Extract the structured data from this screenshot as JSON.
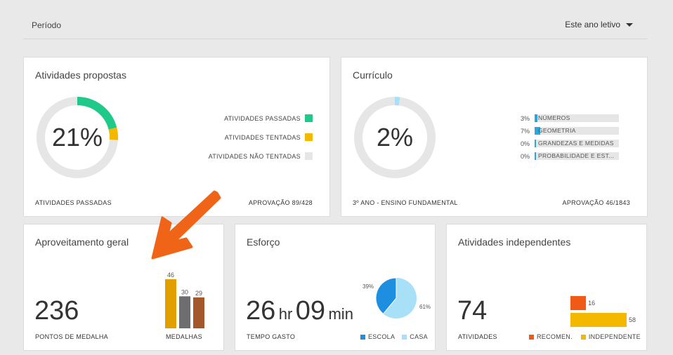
{
  "topbar": {
    "period_label": "Período",
    "period_value": "Este ano letivo"
  },
  "colors": {
    "passed": "#1fc98a",
    "attempted": "#f5b800",
    "not_attempted": "#e6e6e6",
    "curriculum": "#29a8e0",
    "bar_gold": "#e2a000",
    "bar_silver": "#6e6e70",
    "bar_bronze": "#a4572a",
    "school": "#1e8ee0",
    "home": "#a7e0f7",
    "recom": "#f05a14",
    "indep": "#f5b800",
    "arrow": "#f06418"
  },
  "atividades_propostas": {
    "title": "Atividades propostas",
    "donut_value": "21%",
    "passed_fraction": 0.21,
    "attempted_fraction": 0.05,
    "legend": [
      "ATIVIDADES PASSADAS",
      "ATIVIDADES TENTADAS",
      "ATIVIDADES NÃO TENTADAS"
    ],
    "footer_left": "ATIVIDADES PASSADAS",
    "footer_right": "APROVAÇÃO 89/428"
  },
  "curriculo": {
    "title": "Currículo",
    "donut_value": "2%",
    "fraction": 0.02,
    "rows": [
      {
        "pct": "3%",
        "label": "NÚMEROS",
        "value": 0.03
      },
      {
        "pct": "7%",
        "label": "GEOMETRIA",
        "value": 0.07
      },
      {
        "pct": "0%",
        "label": "GRANDEZAS E MEDIDAS",
        "value": 0
      },
      {
        "pct": "0%",
        "label": "PROBABILIDADE E EST...",
        "value": 0
      }
    ],
    "footer_left": "3º ANO - ENSINO FUNDAMENTAL",
    "footer_right": "APROVAÇÃO 46/1843"
  },
  "aproveitamento": {
    "title": "Aproveitamento geral",
    "points": "236",
    "points_label": "PONTOS DE MEDALHA",
    "medals_label": "MEDALHAS",
    "medals": [
      {
        "value": 46,
        "label": "46"
      },
      {
        "value": 30,
        "label": "30"
      },
      {
        "value": 29,
        "label": "29"
      }
    ]
  },
  "esforco": {
    "title": "Esforço",
    "hours": "26",
    "hours_unit": "hr",
    "minutes": "09",
    "minutes_unit": "min",
    "footer_left": "TEMPO GASTO",
    "school_pct": 39,
    "home_pct": 61,
    "school_label": "39%",
    "home_label": "61%",
    "legend_school": "ESCOLA",
    "legend_home": "CASA"
  },
  "independentes": {
    "title": "Atividades independentes",
    "count": "74",
    "footer_left": "ATIVIDADES",
    "bars": [
      {
        "value": 16,
        "label": "16"
      },
      {
        "value": 58,
        "label": "58"
      }
    ],
    "legend_recom": "RECOMEN.",
    "legend_indep": "INDEPENDENTE"
  }
}
